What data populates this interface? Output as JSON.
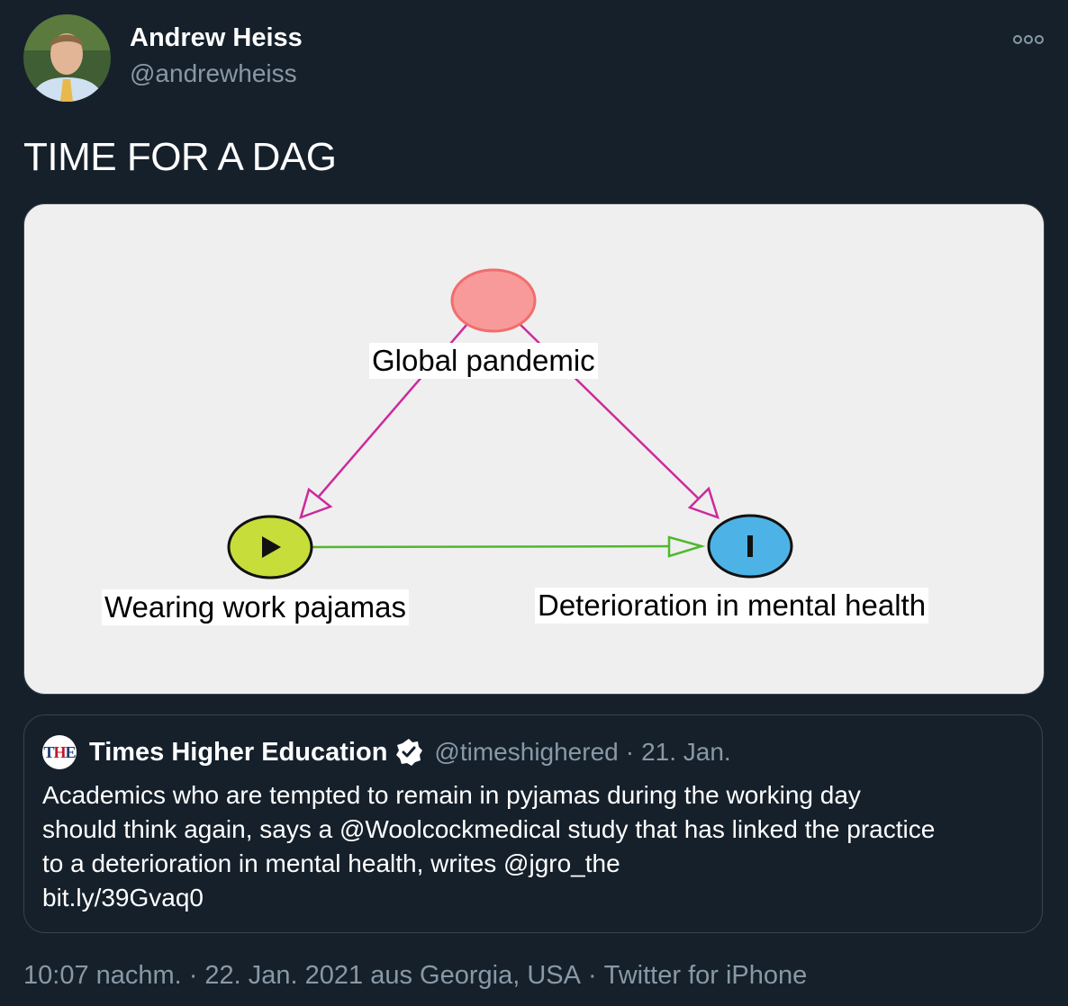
{
  "author": {
    "name": "Andrew Heiss",
    "handle": "@andrewheiss"
  },
  "more_icon": "more-dots-icon",
  "tweet": {
    "text": "TIME FOR A DAG"
  },
  "dag": {
    "nodes": {
      "pandemic": {
        "label": "Global pandemic",
        "color": "#f99a9a"
      },
      "pajamas": {
        "label": "Wearing work pajamas",
        "color": "#c6dd3a",
        "marker": "▶"
      },
      "mental": {
        "label": "Deterioration in mental health",
        "color": "#4db3e6",
        "marker": "I"
      }
    },
    "edges": [
      {
        "from": "Global pandemic",
        "to": "Wearing work pajamas",
        "color": "#cc2a9c"
      },
      {
        "from": "Global pandemic",
        "to": "Deterioration in mental health",
        "color": "#cc2a9c"
      },
      {
        "from": "Wearing work pajamas",
        "to": "Deterioration in mental health",
        "color": "#4fb82d"
      }
    ]
  },
  "quote": {
    "logo_letters": [
      "T",
      "H",
      "E"
    ],
    "name": "Times Higher Education",
    "verified_icon": "verified-badge-icon",
    "handle": "@timeshighered",
    "separator": "·",
    "date": "21. Jan.",
    "lines": [
      "Academics who are tempted to remain in pyjamas during the working day",
      "should think again, says a @Woolcockmedical study that has linked the practice",
      "to a deterioration in mental health, writes @jgro_the",
      "bit.ly/39Gvaq0"
    ]
  },
  "footer": {
    "time": "10:07 nachm.",
    "dot": "·",
    "date_location": "22. Jan. 2021 aus Georgia, USA",
    "source": "Twitter for iPhone"
  }
}
